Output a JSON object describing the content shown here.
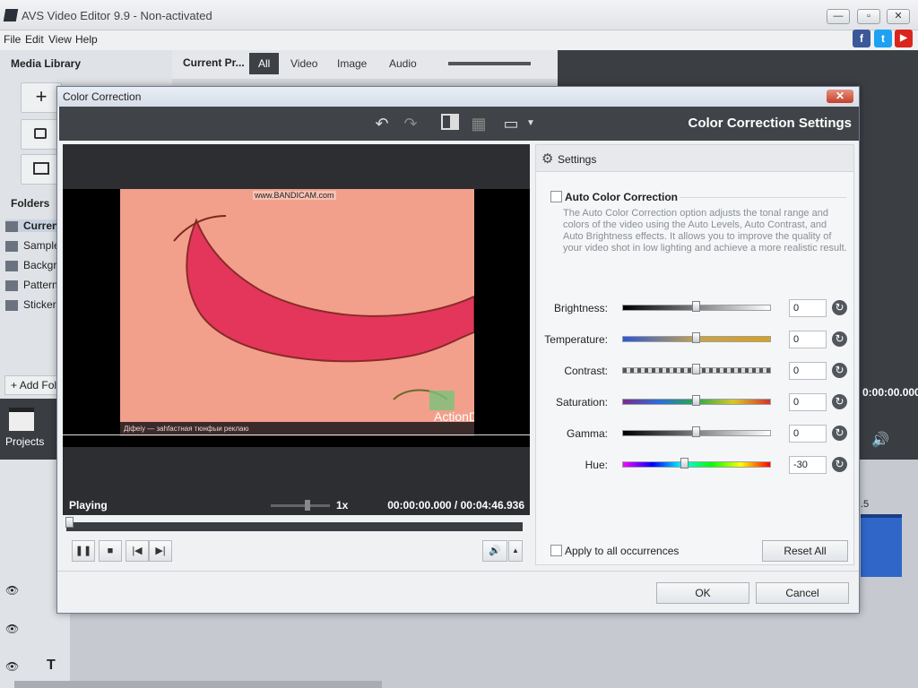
{
  "app": {
    "title": "AVS Video Editor 9.9 - Non-activated"
  },
  "menu": [
    "File",
    "Edit",
    "View",
    "Help"
  ],
  "social": [
    {
      "name": "facebook",
      "glyph": "f",
      "color": "#3b5998"
    },
    {
      "name": "twitter",
      "glyph": "t",
      "color": "#1da1f2"
    },
    {
      "name": "youtube",
      "glyph": "▶",
      "color": "#d9251d"
    }
  ],
  "library": {
    "title": "Media Library",
    "current": "Current Pr...",
    "tabs": [
      "All",
      "Video",
      "Image",
      "Audio"
    ],
    "folders_title": "Folders",
    "folders": [
      "Curren",
      "Sample",
      "Backgro",
      "Pattern",
      "Stickers"
    ],
    "add_folder": "Add Fol",
    "projects": "Projects",
    "bg_time": "0:00:00.000",
    "ruler_mark": ".5"
  },
  "dialog": {
    "title": "Color Correction",
    "heading": "Color Correction Settings",
    "player": {
      "status": "Playing",
      "speed": "1x",
      "time_current": "00:00:00.000",
      "time_separator": "/",
      "time_total": "00:04:46.936",
      "watermark": "www.BANDICAM.com",
      "overlay": "ActionDirector",
      "caption": "Дiфeiy — заhfастнaя тюнфыи реклаю"
    },
    "settings": {
      "tab": "Settings",
      "auto_label": "Auto Color Correction",
      "auto_checked": false,
      "description": "The Auto Color Correction option adjusts the tonal range and colors of the video using the Auto Levels, Auto Contrast, and Auto Brightness effects. It allows you to improve the quality of your video shot in low lighting and achieve a more realistic result.",
      "sliders": [
        {
          "label": "Brightness:",
          "value": "0",
          "level": 0.5,
          "gradient": "linear-gradient(90deg,#000,#fff)"
        },
        {
          "label": "Temperature:",
          "value": "0",
          "level": 0.5,
          "gradient": "linear-gradient(90deg,#2e56d6,#c8a34a,#d9a21e)"
        },
        {
          "label": "Contrast:",
          "value": "0",
          "level": 0.5,
          "gradient": "repeating-linear-gradient(90deg,#555 0 4px,#ddd 4px 8px)"
        },
        {
          "label": "Saturation:",
          "value": "0",
          "level": 0.5,
          "gradient": "linear-gradient(90deg,#7a2b8c,#2c6fd6,#2aa84a,#d8c82a,#d6332a)"
        },
        {
          "label": "Gamma:",
          "value": "0",
          "level": 0.5,
          "gradient": "linear-gradient(90deg,#000,#fff)"
        },
        {
          "label": "Hue:",
          "value": "-30",
          "level": 0.42,
          "gradient": "linear-gradient(90deg,#ff00ff,#0000ff,#00ffff,#00ff00,#ffff00,#ff0000)"
        }
      ],
      "apply_all": "Apply to all occurrences",
      "reset_all": "Reset All"
    },
    "ok": "OK",
    "cancel": "Cancel"
  }
}
